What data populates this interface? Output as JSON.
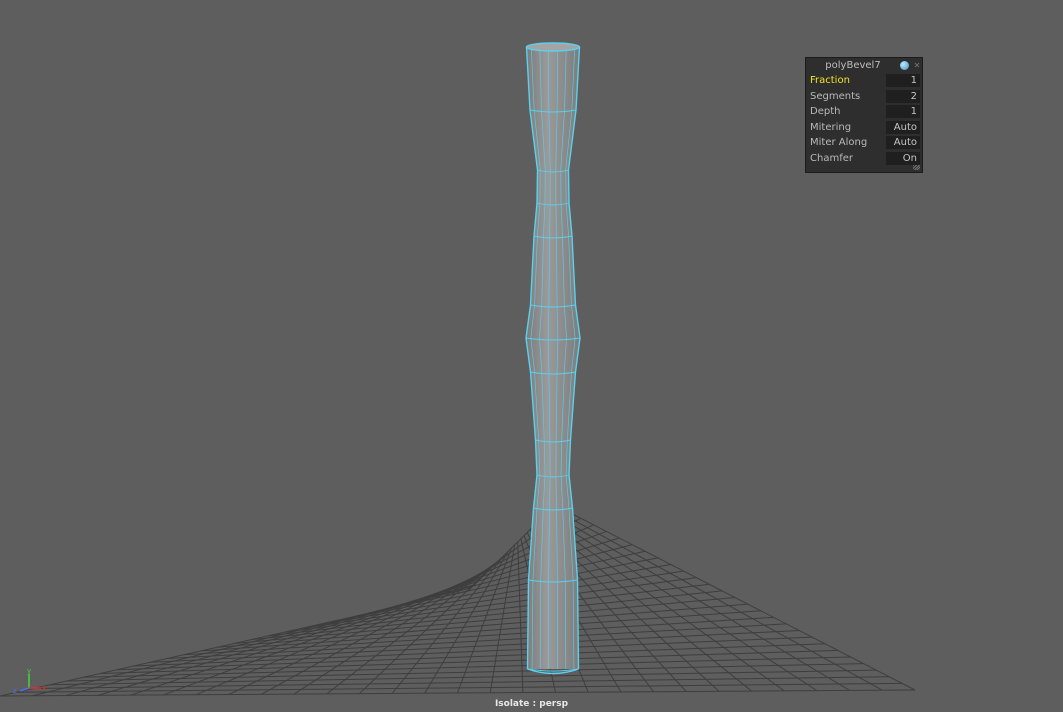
{
  "viewport": {
    "camera": "persp",
    "status_text": "Isolate : persp",
    "background_color": "#5e5e5e",
    "wireframe_color": "#5ad1ef"
  },
  "tool_settings": {
    "title": "polyBevel7",
    "pin_icon": "pin-icon",
    "close_icon": "close-icon",
    "rows": [
      {
        "label": "Fraction",
        "value": "1"
      },
      {
        "label": "Segments",
        "value": "2"
      },
      {
        "label": "Depth",
        "value": "1"
      },
      {
        "label": "Mitering",
        "value": "Auto"
      },
      {
        "label": "Miter Along",
        "value": "Auto"
      },
      {
        "label": "Chamfer",
        "value": "On"
      }
    ]
  },
  "axis_gizmo": {
    "x": "x",
    "y": "y",
    "z": "z"
  }
}
